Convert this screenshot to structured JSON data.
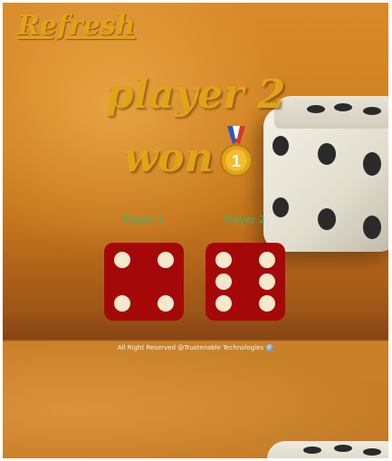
{
  "header": {
    "refresh_label": "Refresh"
  },
  "result": {
    "line1": "player 2",
    "line2": "won",
    "medal_number": "1",
    "medal_icon": "gold-medal-icon"
  },
  "players": [
    {
      "label": "Player 1",
      "die_value": 4
    },
    {
      "label": "Player 2",
      "die_value": 6
    }
  ],
  "footer": {
    "text": "All Right Reserved @Trustenable Technologies",
    "icon": "globe-icon"
  },
  "colors": {
    "title_gold": "#e0a419",
    "player_label_green": "#21c07a",
    "die_red": "#a50808",
    "die_pip": "#f6e8cc"
  }
}
